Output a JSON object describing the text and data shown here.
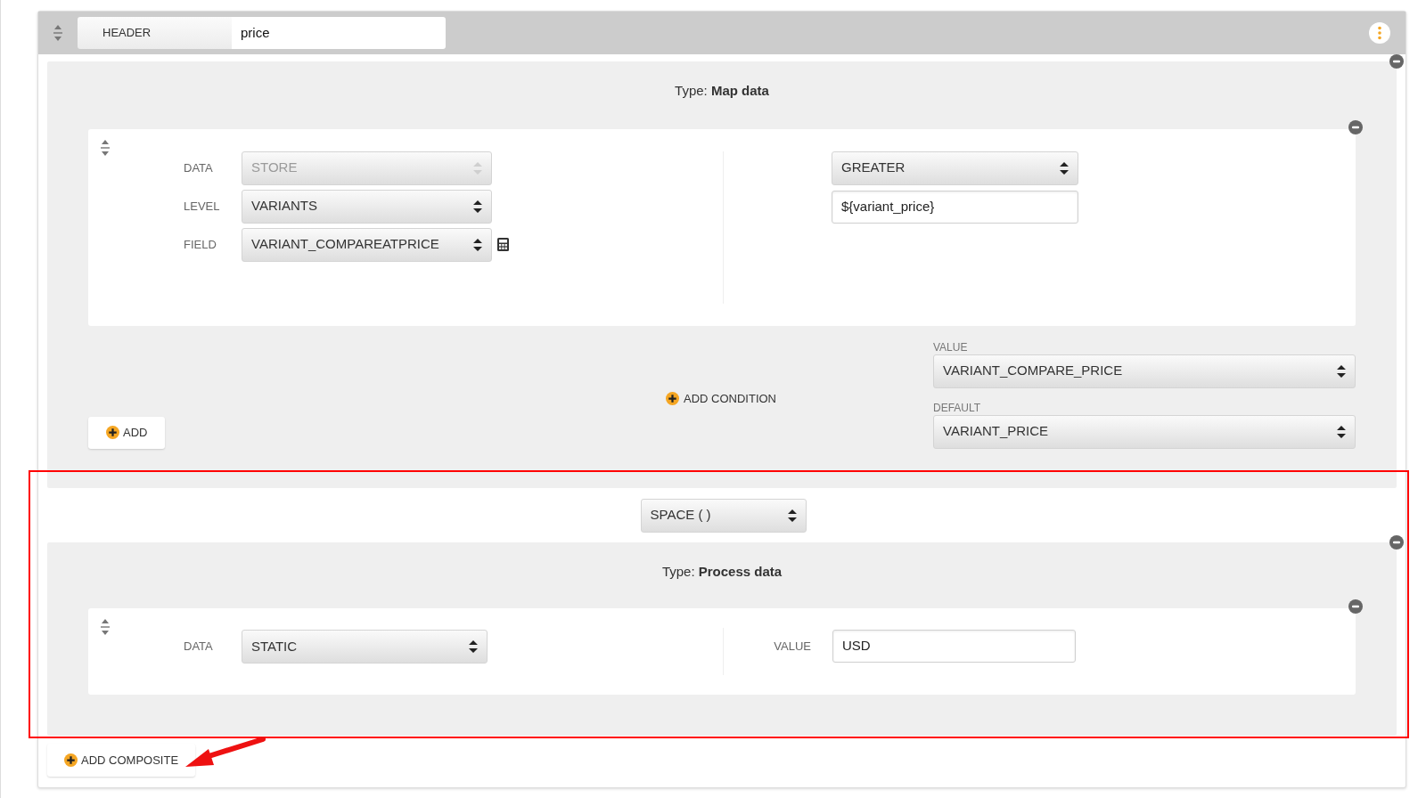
{
  "header": {
    "label": "HEADER",
    "value": "price"
  },
  "map_section": {
    "type_label": "Type:",
    "type_name": "Map data",
    "rows": [
      {
        "label": "DATA",
        "value": "STORE",
        "disabled": true,
        "calculator": false
      },
      {
        "label": "LEVEL",
        "value": "VARIANTS",
        "disabled": false,
        "calculator": false
      },
      {
        "label": "FIELD",
        "value": "VARIANT_COMPAREATPRICE",
        "disabled": false,
        "calculator": true
      }
    ],
    "operator": "GREATER",
    "operand": "${variant_price}",
    "add_condition": "ADD CONDITION",
    "value_label": "VALUE",
    "value_select": "VARIANT_COMPARE_PRICE",
    "default_label": "DEFAULT",
    "default_select": "VARIANT_PRICE",
    "add": "ADD"
  },
  "separator": "SPACE ( )",
  "process_section": {
    "type_label": "Type:",
    "type_name": "Process data",
    "data_label": "DATA",
    "data_value": "STATIC",
    "value_label": "VALUE",
    "value": "USD"
  },
  "add_composite": "ADD COMPOSITE"
}
